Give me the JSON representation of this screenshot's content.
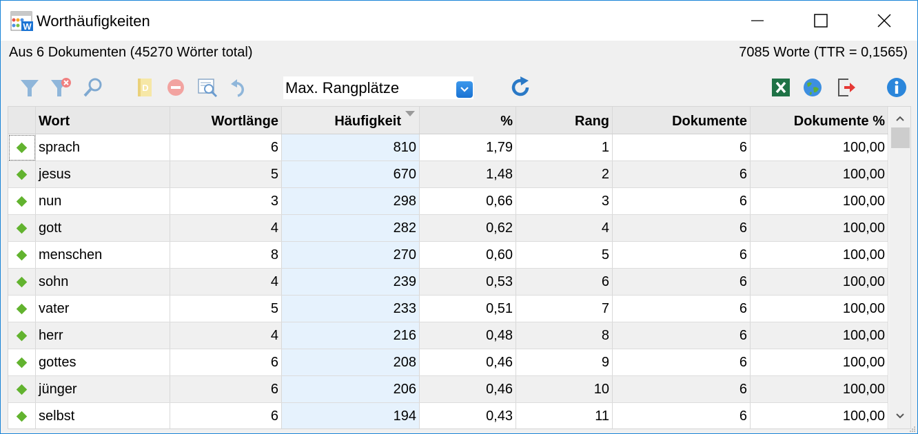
{
  "window": {
    "title": "Worthäufigkeiten",
    "colors": {
      "border": "#1883d7",
      "accent": "#1a73d3",
      "diamond": "#62b32f",
      "sorted_column": "#e6f2fd"
    }
  },
  "info": {
    "left": "Aus 6 Dokumenten (45270 Wörter total)",
    "right": "7085 Worte (TTR = 0,1565)"
  },
  "toolbar": {
    "icons": [
      "filter-icon",
      "clear-filter-icon",
      "search-icon",
      "document-icon",
      "remove-icon",
      "zoom-preview-icon",
      "undo-icon",
      "refresh-icon",
      "excel-icon",
      "globe-icon",
      "export-icon",
      "info-icon"
    ],
    "dropdown": {
      "selected": "Max. Rangplätze"
    }
  },
  "table": {
    "columns": [
      "",
      "Wort",
      "Wortlänge",
      "Häufigkeit",
      "%",
      "Rang",
      "Dokumente",
      "Dokumente %"
    ],
    "sorted_column": "Häufigkeit",
    "rows": [
      {
        "wort": "sprach",
        "laenge": "6",
        "haeufigkeit": "810",
        "prozent": "1,79",
        "rang": "1",
        "dokumente": "6",
        "dokumente_prozent": "100,00"
      },
      {
        "wort": "jesus",
        "laenge": "5",
        "haeufigkeit": "670",
        "prozent": "1,48",
        "rang": "2",
        "dokumente": "6",
        "dokumente_prozent": "100,00"
      },
      {
        "wort": "nun",
        "laenge": "3",
        "haeufigkeit": "298",
        "prozent": "0,66",
        "rang": "3",
        "dokumente": "6",
        "dokumente_prozent": "100,00"
      },
      {
        "wort": "gott",
        "laenge": "4",
        "haeufigkeit": "282",
        "prozent": "0,62",
        "rang": "4",
        "dokumente": "6",
        "dokumente_prozent": "100,00"
      },
      {
        "wort": "menschen",
        "laenge": "8",
        "haeufigkeit": "270",
        "prozent": "0,60",
        "rang": "5",
        "dokumente": "6",
        "dokumente_prozent": "100,00"
      },
      {
        "wort": "sohn",
        "laenge": "4",
        "haeufigkeit": "239",
        "prozent": "0,53",
        "rang": "6",
        "dokumente": "6",
        "dokumente_prozent": "100,00"
      },
      {
        "wort": "vater",
        "laenge": "5",
        "haeufigkeit": "233",
        "prozent": "0,51",
        "rang": "7",
        "dokumente": "6",
        "dokumente_prozent": "100,00"
      },
      {
        "wort": "herr",
        "laenge": "4",
        "haeufigkeit": "216",
        "prozent": "0,48",
        "rang": "8",
        "dokumente": "6",
        "dokumente_prozent": "100,00"
      },
      {
        "wort": "gottes",
        "laenge": "6",
        "haeufigkeit": "208",
        "prozent": "0,46",
        "rang": "9",
        "dokumente": "6",
        "dokumente_prozent": "100,00"
      },
      {
        "wort": "jünger",
        "laenge": "6",
        "haeufigkeit": "206",
        "prozent": "0,46",
        "rang": "10",
        "dokumente": "6",
        "dokumente_prozent": "100,00"
      },
      {
        "wort": "selbst",
        "laenge": "6",
        "haeufigkeit": "194",
        "prozent": "0,43",
        "rang": "11",
        "dokumente": "6",
        "dokumente_prozent": "100,00"
      }
    ]
  }
}
